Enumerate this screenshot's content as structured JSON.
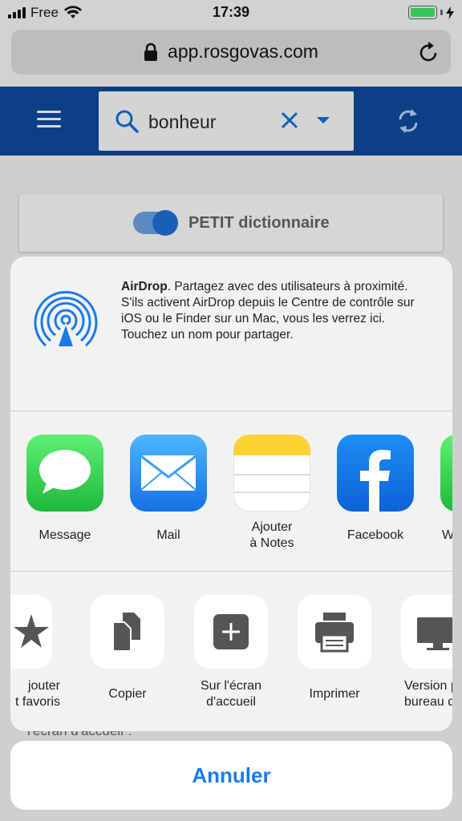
{
  "status_bar": {
    "carrier": "Free",
    "time": "17:39"
  },
  "browser": {
    "url": "app.rosgovas.com"
  },
  "app_header": {
    "search_value": "bonheur"
  },
  "page": {
    "toggle_label": "PETIT dictionnaire",
    "toggle_on": true,
    "hint_text": "l'écran d'accueil\"."
  },
  "share_sheet": {
    "airdrop": {
      "title": "AirDrop",
      "description": ". Partagez avec des utilisateurs à proximité. S'ils activent AirDrop depuis le Centre de contrôle sur iOS ou le Finder sur un Mac, vous les verrez ici. Touchez un nom pour partager."
    },
    "apps": [
      {
        "label": "Message",
        "icon": "messages-icon",
        "color": "#33c759"
      },
      {
        "label": "Mail",
        "icon": "mail-icon",
        "color": "#1f8ef1"
      },
      {
        "label": "Ajouter\nà Notes",
        "icon": "notes-icon",
        "color": "#ffffff"
      },
      {
        "label": "Facebook",
        "icon": "facebook-icon",
        "color": "#1877f2"
      },
      {
        "label": "W",
        "icon": "whatsapp-icon",
        "color": "#33c759"
      }
    ],
    "actions": [
      {
        "label": "jouter\nt favoris",
        "icon": "star-icon"
      },
      {
        "label": "Copier",
        "icon": "copy-icon"
      },
      {
        "label": "Sur l'écran\nd'accueil",
        "icon": "add-icon"
      },
      {
        "label": "Imprimer",
        "icon": "printer-icon"
      },
      {
        "label": "Version p\nbureau du",
        "icon": "desktop-icon"
      }
    ]
  },
  "cancel": {
    "label": "Annuler"
  },
  "colors": {
    "header_blue": "#0b3f86",
    "accent_blue": "#1a7ae8",
    "battery_green": "#35c759"
  }
}
